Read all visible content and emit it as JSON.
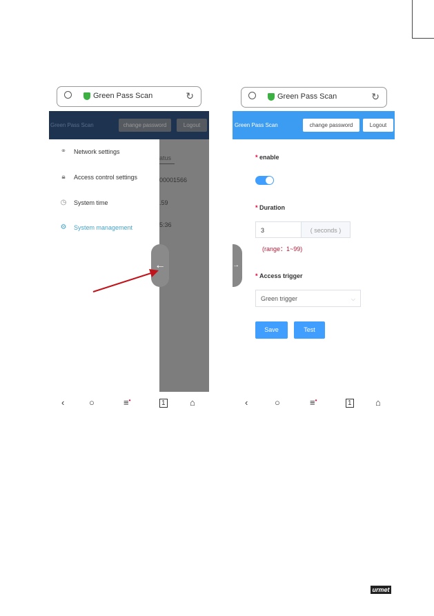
{
  "left_phone": {
    "address_bar": {
      "title": "Green Pass Scan"
    },
    "header": {
      "app_title": "Green Pass Scan",
      "change_password": "change password",
      "logout": "Logout"
    },
    "drawer": {
      "items": [
        {
          "label": "Network settings",
          "icon": "link-icon"
        },
        {
          "label": "Access control settings",
          "icon": "lock-icon"
        },
        {
          "label": "System time",
          "icon": "clock-icon"
        },
        {
          "label": "System management",
          "icon": "gear-icon",
          "active": true
        }
      ]
    },
    "background_fragments": [
      "atus",
      "00001566",
      ".59",
      "5:36"
    ]
  },
  "right_phone": {
    "address_bar": {
      "title": "Green Pass Scan"
    },
    "header": {
      "app_title": "Green Pass Scan",
      "change_password": "change password",
      "logout": "Logout"
    },
    "form": {
      "enable_label": "enable",
      "enable_on": true,
      "duration_label": "Duration",
      "duration_value": "3",
      "duration_unit": "( seconds )",
      "range_hint": "(range：1~99)",
      "trigger_label": "Access trigger",
      "trigger_value": "Green trigger",
      "save": "Save",
      "test": "Test"
    }
  },
  "colors": {
    "header_blue": "#3c9cf2",
    "accent": "#409eff",
    "required": "#e0102f",
    "arrow": "#c0141c"
  },
  "logo": "urmet"
}
